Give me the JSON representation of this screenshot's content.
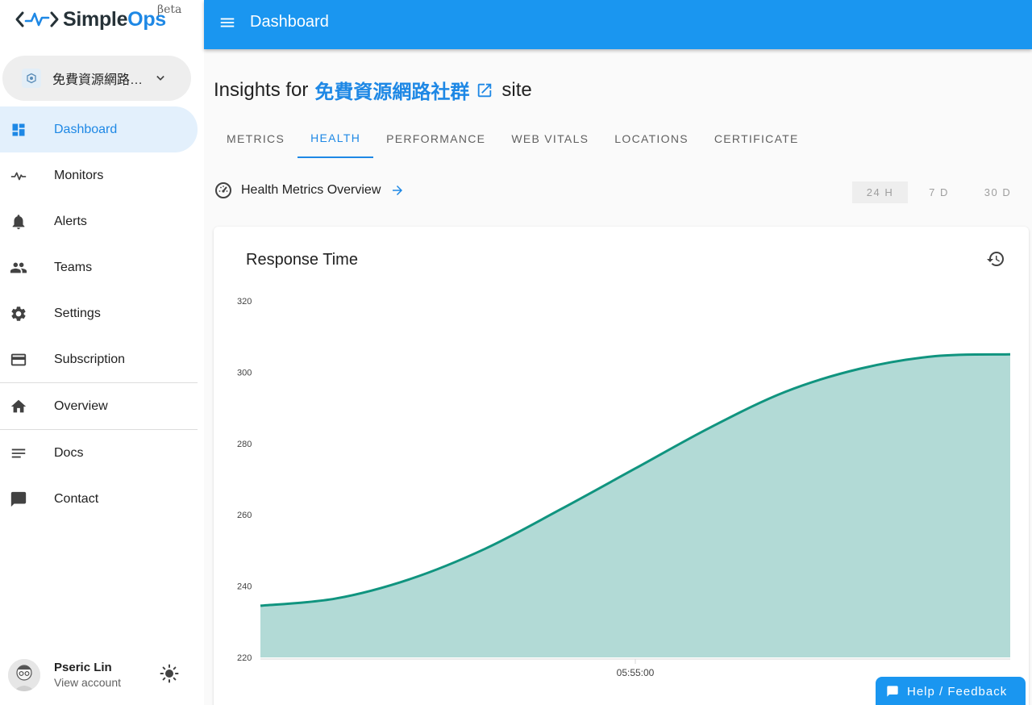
{
  "brand": {
    "name_part1": "Simple",
    "name_part2": "Ops",
    "beta": "βeta"
  },
  "site_selector": {
    "value": "免費資源網路…"
  },
  "sidebar": {
    "items": [
      {
        "label": "Dashboard",
        "icon": "dashboard-icon",
        "active": true
      },
      {
        "label": "Monitors",
        "icon": "pulse-icon"
      },
      {
        "label": "Alerts",
        "icon": "bell-icon"
      },
      {
        "label": "Teams",
        "icon": "people-icon"
      },
      {
        "label": "Settings",
        "icon": "gear-icon"
      },
      {
        "label": "Subscription",
        "icon": "credit-card-icon"
      },
      {
        "label": "Overview",
        "icon": "home-icon"
      },
      {
        "label": "Docs",
        "icon": "notes-icon"
      },
      {
        "label": "Contact",
        "icon": "chat-icon"
      }
    ]
  },
  "account": {
    "name": "Pseric Lin",
    "sub": "View account"
  },
  "topbar": {
    "title": "Dashboard"
  },
  "insight": {
    "prefix": "Insights for",
    "site": "免費資源網路社群",
    "suffix": "site"
  },
  "tabs": [
    {
      "label": "METRICS"
    },
    {
      "label": "HEALTH",
      "active": true
    },
    {
      "label": "PERFORMANCE"
    },
    {
      "label": "WEB VITALS"
    },
    {
      "label": "LOCATIONS"
    },
    {
      "label": "CERTIFICATE"
    }
  ],
  "overview": {
    "label": "Health Metrics Overview"
  },
  "ranges": [
    {
      "label": "24 H",
      "selected": true
    },
    {
      "label": "7 D"
    },
    {
      "label": "30 D"
    }
  ],
  "help": {
    "label": "Help / Feedback"
  },
  "colors": {
    "accent": "#1a96f0",
    "series": "#10947f",
    "fill": "#b2dad6"
  },
  "chart_data": {
    "type": "area",
    "title": "Response Time",
    "xlabel": "",
    "ylabel": "",
    "ylim": [
      220,
      320
    ],
    "yticks": [
      320,
      300,
      280,
      260,
      240,
      220
    ],
    "xticks": [
      "05:55:00"
    ],
    "x": [
      0,
      0.1,
      0.2,
      0.3,
      0.4,
      0.5,
      0.6,
      0.7,
      0.8,
      0.9,
      1.0
    ],
    "series": [
      {
        "values": [
          234.5,
          236.5,
          242,
          250.5,
          261.5,
          273,
          284.5,
          294.5,
          301,
          304.5,
          305
        ]
      }
    ],
    "grid": false,
    "legend": "none"
  }
}
